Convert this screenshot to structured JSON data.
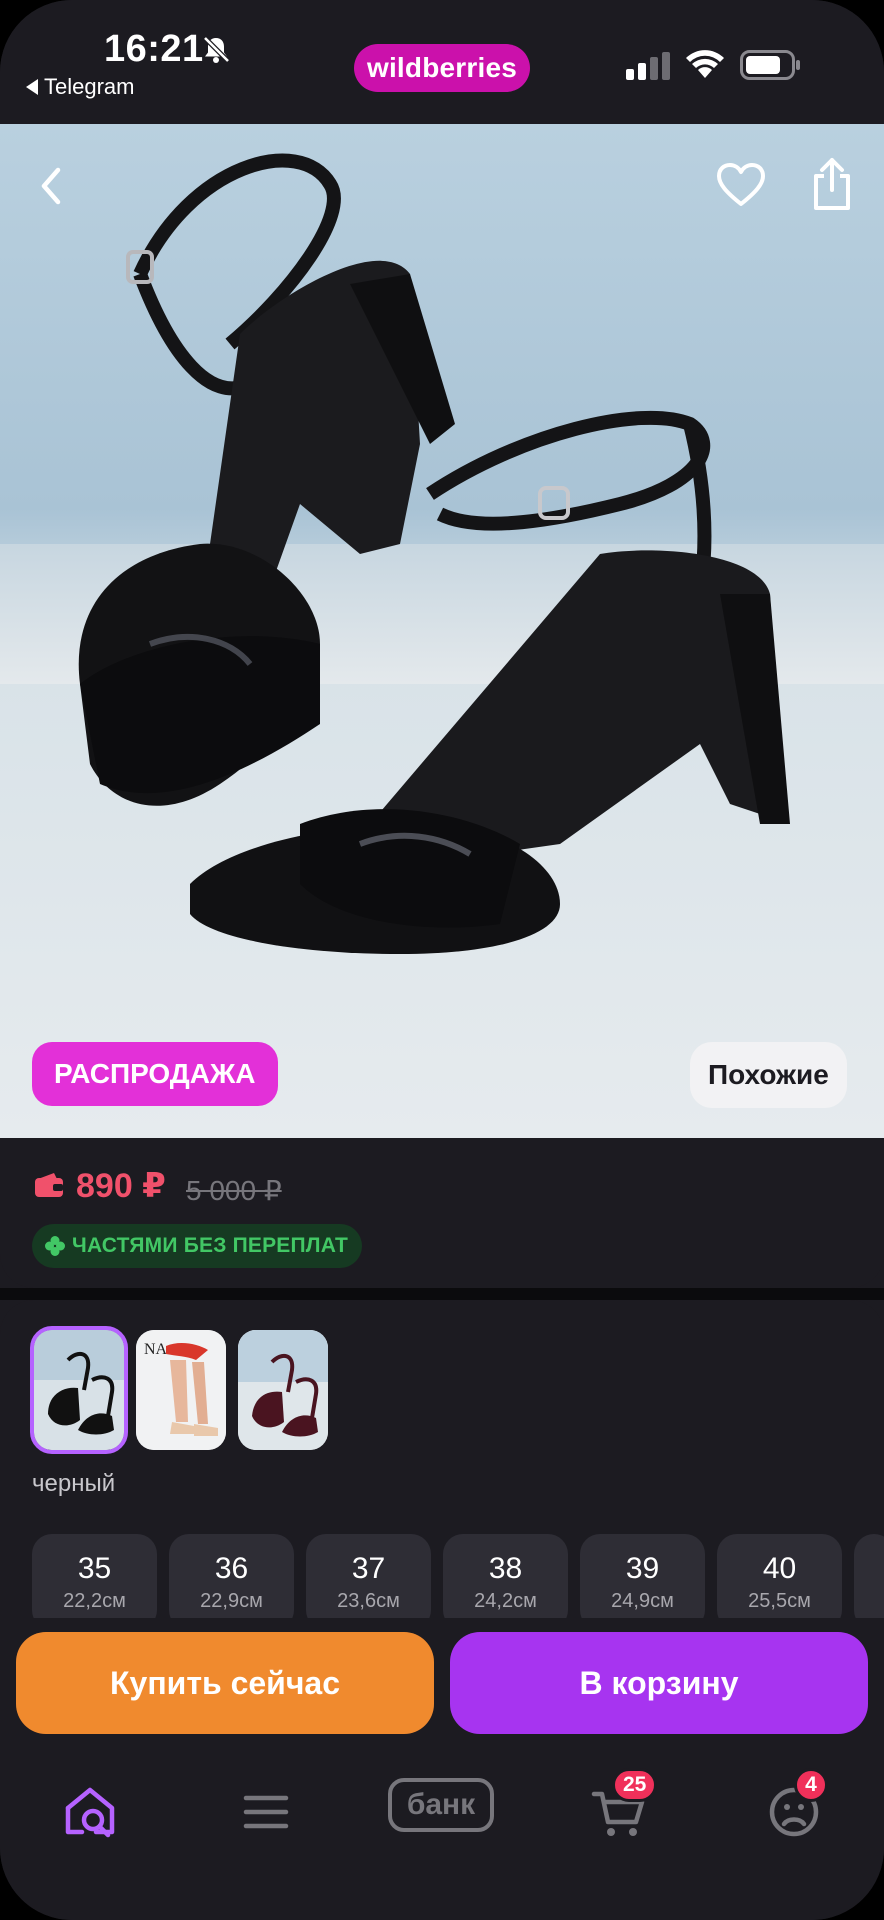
{
  "status_bar": {
    "time": "16:21",
    "back_app": "Telegram",
    "brand": "wildberries"
  },
  "hero": {
    "sale_badge": "РАСПРОДАЖА",
    "similar_button": "Похожие"
  },
  "price": {
    "current": "890 ₽",
    "old": "5 000 ₽",
    "installment": "ЧАСТЯМИ БЕЗ ПЕРЕПЛАТ"
  },
  "variants": {
    "selected_color": "черный",
    "selected_index": 0,
    "thumbnails": [
      "black-sandal",
      "beige-sandal",
      "burgundy-sandal"
    ]
  },
  "sizes": [
    {
      "size": "35",
      "length": "22,2см"
    },
    {
      "size": "36",
      "length": "22,9см"
    },
    {
      "size": "37",
      "length": "23,6см"
    },
    {
      "size": "38",
      "length": "24,2см"
    },
    {
      "size": "39",
      "length": "24,9см"
    },
    {
      "size": "40",
      "length": "25,5см"
    }
  ],
  "actions": {
    "buy_now": "Купить сейчас",
    "add_to_cart": "В корзину"
  },
  "bottom_nav": {
    "bank_label": "банк",
    "cart_count": "25",
    "profile_count": "4"
  },
  "colors": {
    "brand_pink": "#cb11ab",
    "price_red": "#f0516b",
    "buy_orange": "#f08a2e",
    "cart_purple": "#a734f0",
    "sale_pink": "#e330d8",
    "installment_green": "#42c765"
  }
}
